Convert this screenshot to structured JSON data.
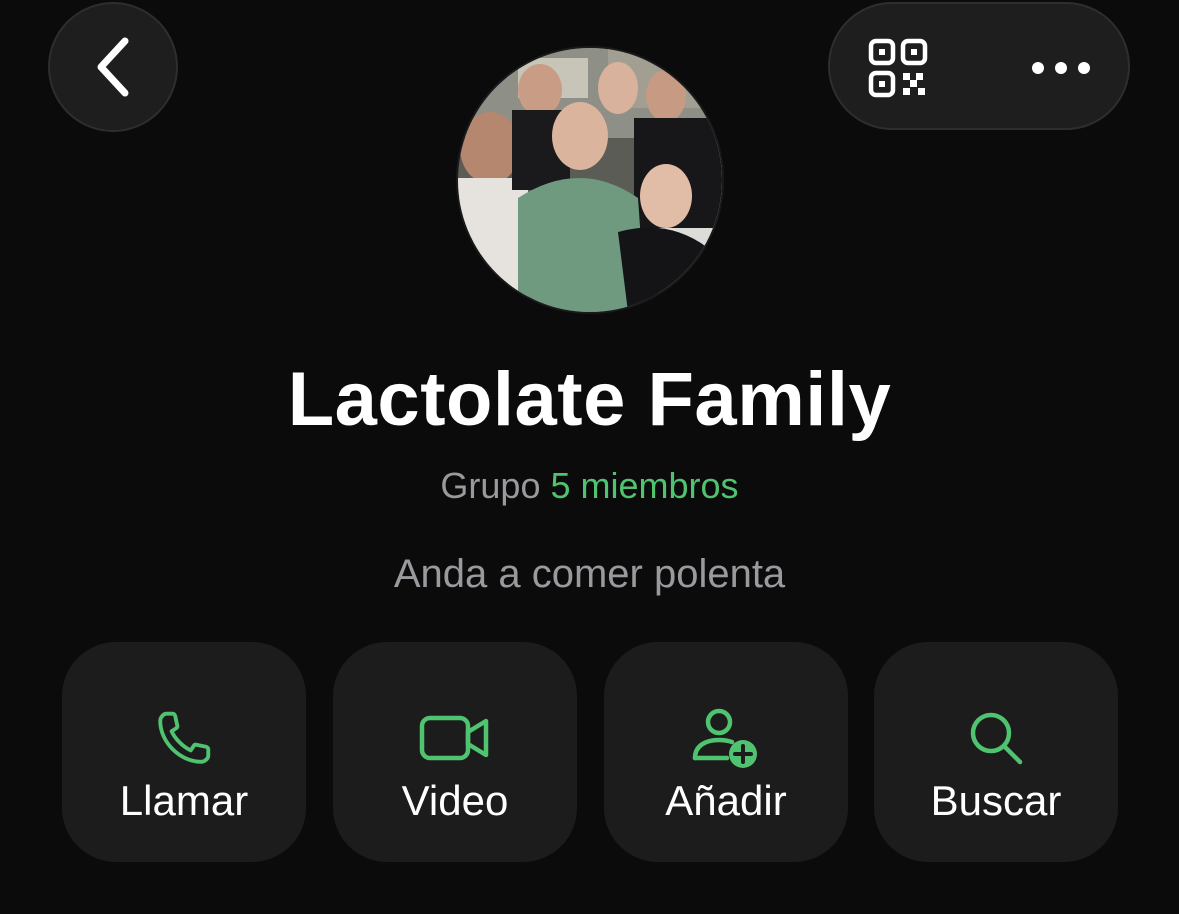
{
  "header": {
    "back_icon": "chevron-left-icon",
    "qr_icon": "qr-code-icon",
    "more_icon": "more-horizontal-icon"
  },
  "group": {
    "name": "Lactolate Family",
    "kind": "Grupo",
    "members": "5 miembros",
    "description": "Anda a comer polenta"
  },
  "actions": [
    {
      "label": "Llamar",
      "icon": "phone-icon"
    },
    {
      "label": "Video",
      "icon": "video-camera-icon"
    },
    {
      "label": "Añadir",
      "icon": "add-person-icon"
    },
    {
      "label": "Buscar",
      "icon": "search-icon"
    }
  ],
  "colors": {
    "accent": "#4fc36f",
    "background": "#0b0b0b",
    "button_bg": "#1c1c1d",
    "secondary_text": "#9a9a9e"
  }
}
